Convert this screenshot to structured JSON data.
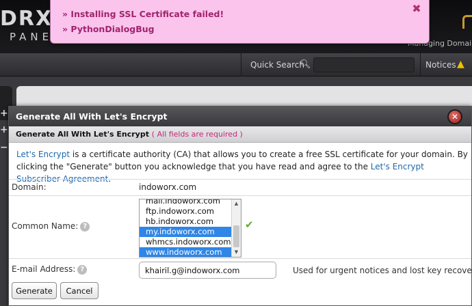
{
  "app": {
    "logo_text": "DRX",
    "logo_sub": "PANEL",
    "managing_domain_label": "Managing Domain: i",
    "quick_search_label": "Quick Search",
    "notices_label": "Notices"
  },
  "notification": {
    "lines": [
      "» Installing SSL Certificate failed!",
      "» PythonDialogBug"
    ],
    "close_glyph": "✖",
    "color": "#a0246e",
    "background": "#fbc4ec"
  },
  "dialog": {
    "title": "Generate All With Let's Encrypt",
    "close_glyph": "✕",
    "subheader": "Generate All With Let's Encrypt",
    "subheader_required": "( All fields are required )",
    "intro_link": "Let's Encrypt",
    "intro_text_1": " is a certificate authority (CA) that allows you to create a free SSL certificate for your domain. By clicking the \"Generate\" button you acknowledge that you have read and agree to the ",
    "intro_link_2": "Let's Encrypt Subscriber Agreement",
    "intro_text_2": ".",
    "fields": {
      "domain_label": "Domain:",
      "domain_value": "indoworx.com",
      "common_name_label": "Common Name:",
      "common_name_options": [
        {
          "label": "mail.indoworx.com",
          "selected": false
        },
        {
          "label": "ftp.indoworx.com",
          "selected": false
        },
        {
          "label": "hb.indoworx.com",
          "selected": false
        },
        {
          "label": "my.indoworx.com",
          "selected": true
        },
        {
          "label": "whmcs.indoworx.com",
          "selected": false
        },
        {
          "label": "www.indoworx.com",
          "selected": true
        }
      ],
      "email_label": "E-mail Address:",
      "email_value": "khairil.g@indoworx.com",
      "email_hint": "Used for urgent notices and lost key recovery."
    },
    "buttons": {
      "generate": "Generate",
      "cancel": "Cancel"
    },
    "colors": {
      "link": "#1e67ad",
      "required": "#c4287a",
      "selection": "#2f86e6",
      "valid": "#5fae2b"
    }
  },
  "icons": {
    "search": "search-icon",
    "warning": "warning-icon",
    "help": "help-icon",
    "check": "check-icon"
  }
}
